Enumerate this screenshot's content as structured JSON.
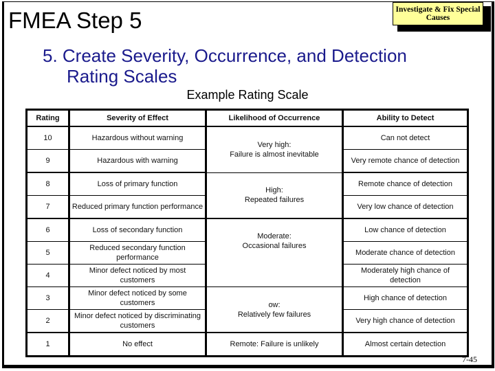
{
  "header": {
    "title": "FMEA Step 5",
    "badge_line1": "Investigate & Fix Special",
    "badge_line2": "Causes"
  },
  "subtitle": {
    "line1": "5.  Create Severity, Occurrence, and Detection",
    "line2": "Rating Scales"
  },
  "caption": "Example Rating Scale",
  "table": {
    "headers": [
      "Rating",
      "Severity of Effect",
      "Likelihood of Occurrence",
      "Ability to Detect"
    ],
    "rows": [
      {
        "rating": "10",
        "severity": "Hazardous without warning",
        "detect": "Can not detect"
      },
      {
        "rating": "9",
        "severity": "Hazardous with warning",
        "detect": "Very remote chance of detection"
      },
      {
        "rating": "8",
        "severity": "Loss of primary function",
        "detect": "Remote chance of detection"
      },
      {
        "rating": "7",
        "severity": "Reduced primary function performance",
        "detect": "Very low chance of detection"
      },
      {
        "rating": "6",
        "severity": "Loss of secondary function",
        "detect": "Low chance of detection"
      },
      {
        "rating": "5",
        "severity": "Reduced secondary function performance",
        "detect": "Moderate chance of detection"
      },
      {
        "rating": "4",
        "severity": "Minor defect noticed by most customers",
        "detect": "Moderately high chance of detection"
      },
      {
        "rating": "3",
        "severity": "Minor defect noticed by some customers",
        "detect": "High chance of detection"
      },
      {
        "rating": "2",
        "severity": "Minor defect noticed by discriminating customers",
        "detect": "Very high chance of detection"
      },
      {
        "rating": "1",
        "severity": "No effect",
        "detect": "Almost certain detection"
      }
    ],
    "occurrence_groups": [
      {
        "line1": "Very high:",
        "line2": "Failure is almost inevitable"
      },
      {
        "line1": "High:",
        "line2": "Repeated failures"
      },
      {
        "line1": "Moderate:",
        "line2": "Occasional failures"
      },
      {
        "line1": "ow:",
        "line2": "Relatively few failures"
      },
      {
        "line1": "Remote:  Failure is unlikely",
        "line2": ""
      }
    ]
  },
  "footer": {
    "page_number": "7-45"
  }
}
